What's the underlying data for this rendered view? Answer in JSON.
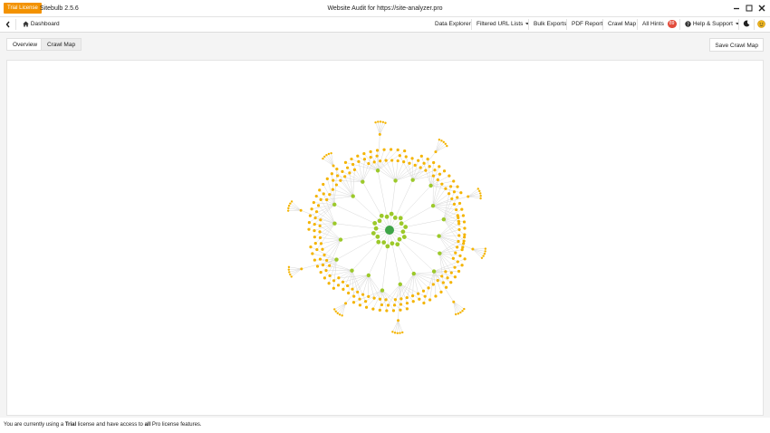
{
  "titlebar": {
    "license_badge": "Trial License",
    "app_version": "Sitebulb 2.5.6",
    "window_title": "Website Audit for https://site-analyzer.pro"
  },
  "toolbar": {
    "dashboard": "Dashboard",
    "data_explorer": "Data Explorer",
    "filtered_url_lists": "Filtered URL Lists",
    "bulk_exports": "Bulk Exports",
    "pdf_report": "PDF Report",
    "crawl_map": "Crawl Map",
    "all_hints": "All Hints",
    "hints_count": "89",
    "help_support": "Help & Support"
  },
  "tabs": [
    {
      "label": "Overview",
      "active": false
    },
    {
      "label": "Crawl Map",
      "active": true
    }
  ],
  "save_button": "Save Crawl Map",
  "crawl_map": {
    "root_color": "#3ea548",
    "level1_color": "#9cc92a",
    "level2_color": "#f4b400",
    "edge_color": "#d8d8d8",
    "branches": 20
  },
  "status": {
    "prefix": "You are currently using a ",
    "license": "Trial",
    "middle": " license and have access to ",
    "scope": "all",
    "suffix": " Pro license features."
  }
}
